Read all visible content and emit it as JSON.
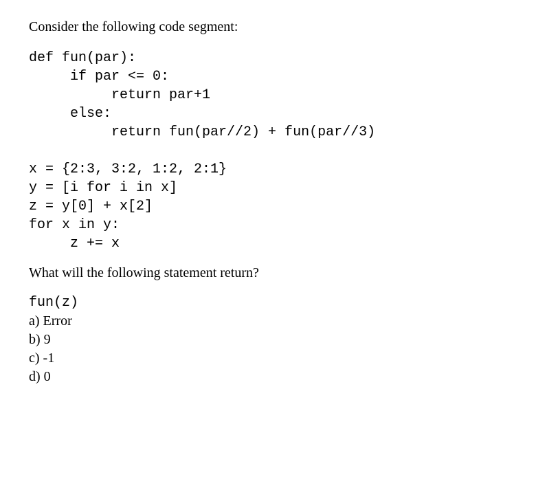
{
  "intro": "Consider the following code segment:",
  "code": {
    "line1": "def fun(par):",
    "line2": "     if par <= 0:",
    "line3": "          return par+1",
    "line4": "     else:",
    "line5": "          return fun(par//2) + fun(par//3)",
    "line6": "",
    "line7": "x = {2:3, 3:2, 1:2, 2:1}",
    "line8": "y = [i for i in x]",
    "line9": "z = y[0] + x[2]",
    "line10": "for x in y:",
    "line11": "     z += x"
  },
  "question": "What will the following statement return?",
  "call": "fun(z)",
  "options": {
    "a": "a) Error",
    "b": "b) 9",
    "c": "c) -1",
    "d": "d) 0"
  }
}
